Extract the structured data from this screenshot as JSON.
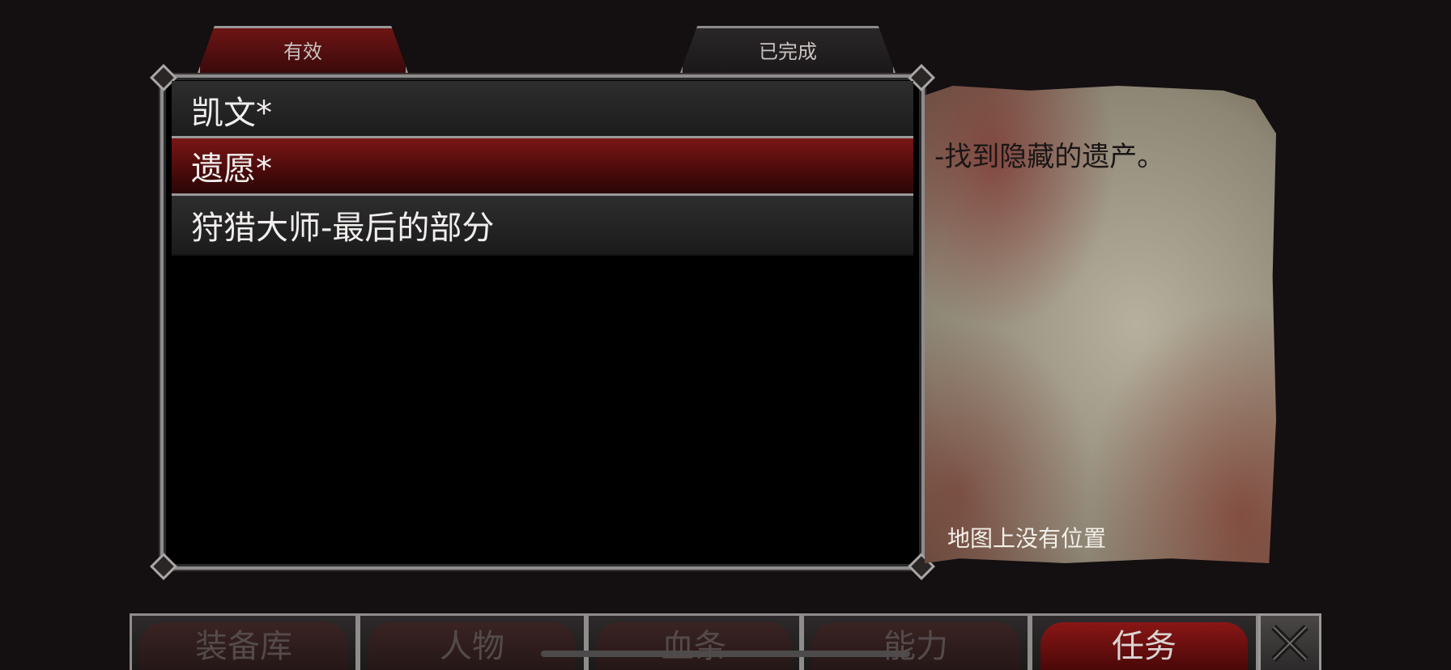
{
  "tabs": {
    "active_label": "有效",
    "completed_label": "已完成"
  },
  "quests": [
    {
      "title": "凯文*"
    },
    {
      "title": "遗愿*"
    },
    {
      "title": "狩猎大师-最后的部分"
    }
  ],
  "details": {
    "objective": "-找到隐藏的遗产。",
    "map_note": "地图上没有位置"
  },
  "nav": {
    "inventory": "装备库",
    "character": "人物",
    "bloodline": "血条",
    "abilities": "能力",
    "quests": "任务",
    "close_icon": "close-x-icon"
  },
  "colors": {
    "accent_red": "#7a1616",
    "frame_gray": "#8e8c8c",
    "background": "#140f11"
  }
}
